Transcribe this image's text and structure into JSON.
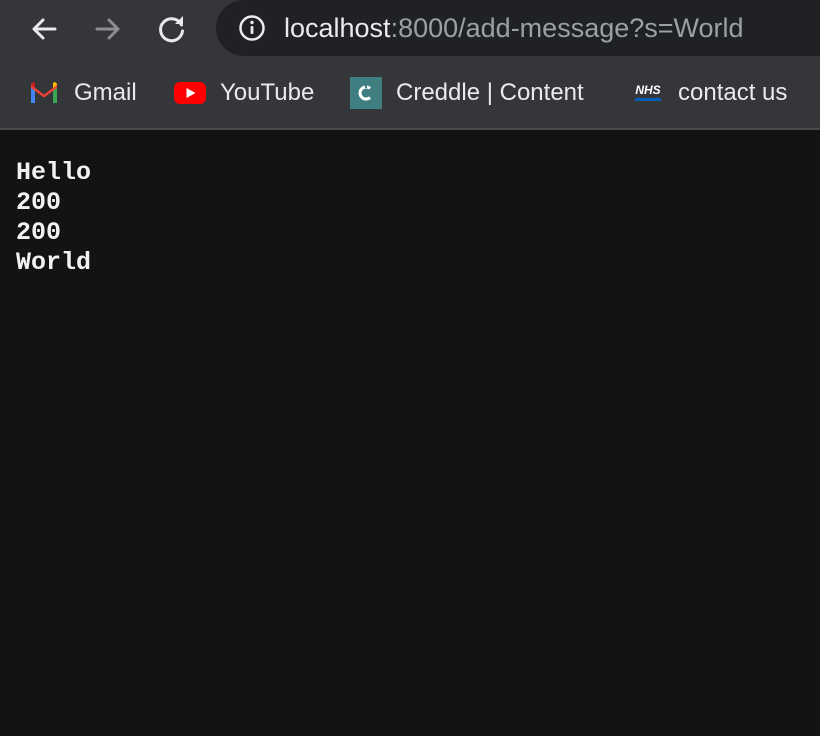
{
  "toolbar": {
    "back_icon": "arrow-left-icon",
    "forward_icon": "arrow-right-icon",
    "reload_icon": "reload-icon",
    "info_icon": "info-icon",
    "url_host": "localhost",
    "url_rest": ":8000/add-message?s=World"
  },
  "bookmarks": [
    {
      "label": "Gmail",
      "icon": "gmail-icon"
    },
    {
      "label": "YouTube",
      "icon": "youtube-icon"
    },
    {
      "label": "Creddle | Content",
      "icon": "creddle-icon"
    },
    {
      "label": "contact us",
      "icon": "nhs-icon",
      "icon_text": "NHS"
    }
  ],
  "content": {
    "lines": [
      "Hello",
      "200",
      "200",
      "World"
    ]
  },
  "colors": {
    "toolbar_bg": "#35363a",
    "omnibox_bg": "#202124",
    "page_bg": "#131313",
    "text": "#f1f1f1"
  }
}
